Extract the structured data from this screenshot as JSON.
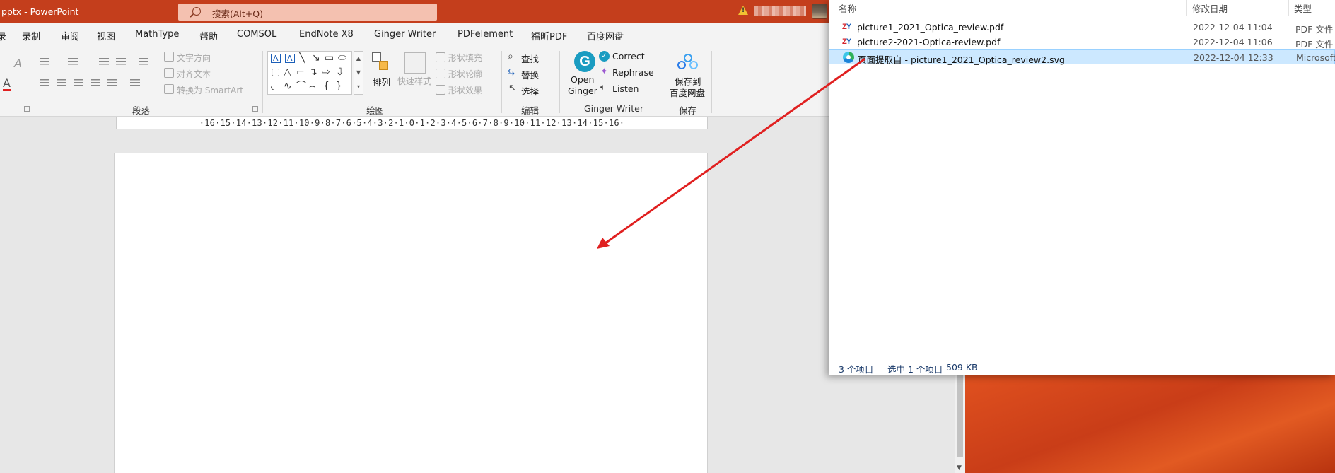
{
  "titlebar": {
    "doc_title": "pptx  -  PowerPoint",
    "search_placeholder": "搜索(Alt+Q)"
  },
  "tabs": [
    "录制",
    "审阅",
    "视图",
    "MathType",
    "帮助",
    "COMSOL",
    "EndNote X8",
    "Ginger Writer",
    "PDFelement",
    "福昕PDF",
    "百度网盘"
  ],
  "tab_fragment": "录",
  "ribbon": {
    "paragraph": {
      "label": "段落",
      "text_direction": "文字方向",
      "align_text": "对齐文本",
      "smartart": "转换为 SmartArt"
    },
    "drawing": {
      "label": "绘图",
      "arrange": "排列",
      "quick_styles": "快速样式",
      "shape_fill": "形状填充",
      "shape_outline": "形状轮廓",
      "shape_effects": "形状效果"
    },
    "editing": {
      "label": "编辑",
      "find": "查找",
      "replace": "替换",
      "select": "选择"
    },
    "ginger": {
      "label": "Ginger Writer",
      "open_line1": "Open",
      "open_line2": "Ginger",
      "correct": "Correct",
      "rephrase": "Rephrase",
      "listen": "Listen"
    },
    "save": {
      "label": "保存",
      "save_line1": "保存到",
      "save_line2": "百度网盘"
    }
  },
  "ruler_text": "·16·15·14·13·12·11·10·9·8·7·6·5·4·3·2·1·0·1·2·3·4·5·6·7·8·9·10·11·12·13·14·15·16·",
  "explorer": {
    "columns": {
      "name": "名称",
      "modified": "修改日期",
      "type": "类型"
    },
    "files": [
      {
        "name": "picture1_2021_Optica_review.pdf",
        "modified": "2022-12-04 11:04",
        "type": "PDF 文件",
        "icon": "pdf-icon",
        "selected": false
      },
      {
        "name": "picture2-2021-Optica-review.pdf",
        "modified": "2022-12-04 11:06",
        "type": "PDF 文件",
        "icon": "pdf-icon",
        "selected": false
      },
      {
        "name": "页面提取自 - picture1_2021_Optica_review2.svg",
        "modified": "2022-12-04 12:33",
        "type": "Microsoft",
        "icon": "edge-icon",
        "selected": true
      }
    ],
    "status": {
      "count": "3 个项目",
      "selected": "选中 1 个项目",
      "size": "509 KB"
    }
  },
  "annotation": {
    "color": "#e02020"
  },
  "colors": {
    "titlebar": "#c43e1c",
    "selection": "#cce8ff",
    "accent_ginger": "#1a9cc1"
  }
}
